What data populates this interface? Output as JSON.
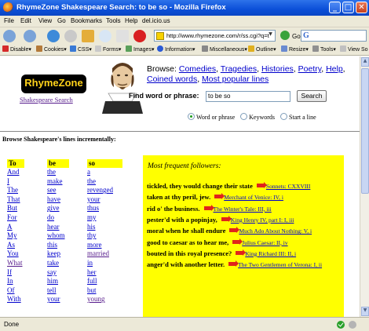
{
  "window": {
    "title": "RhymeZone Shakespeare Search: to be so - Mozilla Firefox",
    "minimize": "_",
    "maximize": "□",
    "close": "✕"
  },
  "menu": [
    "File",
    "Edit",
    "View",
    "Go",
    "Bookmarks",
    "Tools",
    "Help",
    "del.icio.us"
  ],
  "nav": {
    "url": "http://www.rhymezone.com/r/ss.cgi?q=t",
    "go_label": "Go",
    "search_icon_letter": "G"
  },
  "toolbar": [
    "Disable▾",
    "Cookies▾",
    "CSS▾",
    "Forms▾",
    "Images▾",
    "Information▾",
    "Miscellaneous▾",
    "Outline▾",
    "Resize▾",
    "Tools▾",
    "View So"
  ],
  "header": {
    "logo": "RhymeZone",
    "subtitle_link": "Shakespeare Search",
    "browse_label": "Browse:",
    "browse_links": [
      "Comedies",
      "Tragedies",
      "Histories",
      "Poetry",
      "Help",
      "Coined words",
      "Most popular lines"
    ],
    "find_label": "Find word or phrase:",
    "find_value": "to be so",
    "search_button": "Search",
    "radio_options": [
      {
        "label": "Word or phrase",
        "checked": true
      },
      {
        "label": "Keywords",
        "checked": false
      },
      {
        "label": "Start a line",
        "checked": false
      }
    ]
  },
  "browse_lines_label": "Browse Shakespeare's lines incrementally:",
  "columns": [
    {
      "header": "To",
      "words": [
        "And",
        "I",
        "The",
        "That",
        "But",
        "For",
        "A",
        "My",
        "As",
        "You",
        "What",
        "If",
        "In",
        "Of",
        "With"
      ],
      "visited": [
        10
      ]
    },
    {
      "header": "be",
      "words": [
        "the",
        "make",
        "see",
        "have",
        "give",
        "do",
        "hear",
        "whom",
        "this",
        "keep",
        "take",
        "say",
        "him",
        "tell",
        "your"
      ],
      "visited": []
    },
    {
      "header": "so",
      "words": [
        "a",
        "the",
        "revenged",
        "your",
        "thus",
        "my",
        "his",
        "thy",
        "more",
        "married",
        "in",
        "her",
        "full",
        "but",
        "young"
      ],
      "visited": [
        9,
        14
      ]
    }
  ],
  "followers": {
    "heading": "Most frequent followers:",
    "lines": [
      {
        "text": "tickled, they would change their state",
        "source": "Sonnets: CXXVIII"
      },
      {
        "text": "taken at thy peril, jew.",
        "source": "Merchant of Venice: IV, i"
      },
      {
        "text": "rid o' the business.",
        "source": "The Winter's Tale: III, iii"
      },
      {
        "text": "pester'd with a popinjay,",
        "source": "King Henry IV, part I: I, iii"
      },
      {
        "text": "moral when he shall endure",
        "source": "Much Ado About Nothing: V, i"
      },
      {
        "text": "good to caesar as to hear me,",
        "source": "Julius Caesar: II, iv"
      },
      {
        "text": "bouted in this royal presence?",
        "source": "King Richard III: II, i"
      },
      {
        "text": "anger'd with another letter.",
        "source": "The Two Gentlemen of Verona: I, ii"
      }
    ]
  },
  "status": "Done"
}
